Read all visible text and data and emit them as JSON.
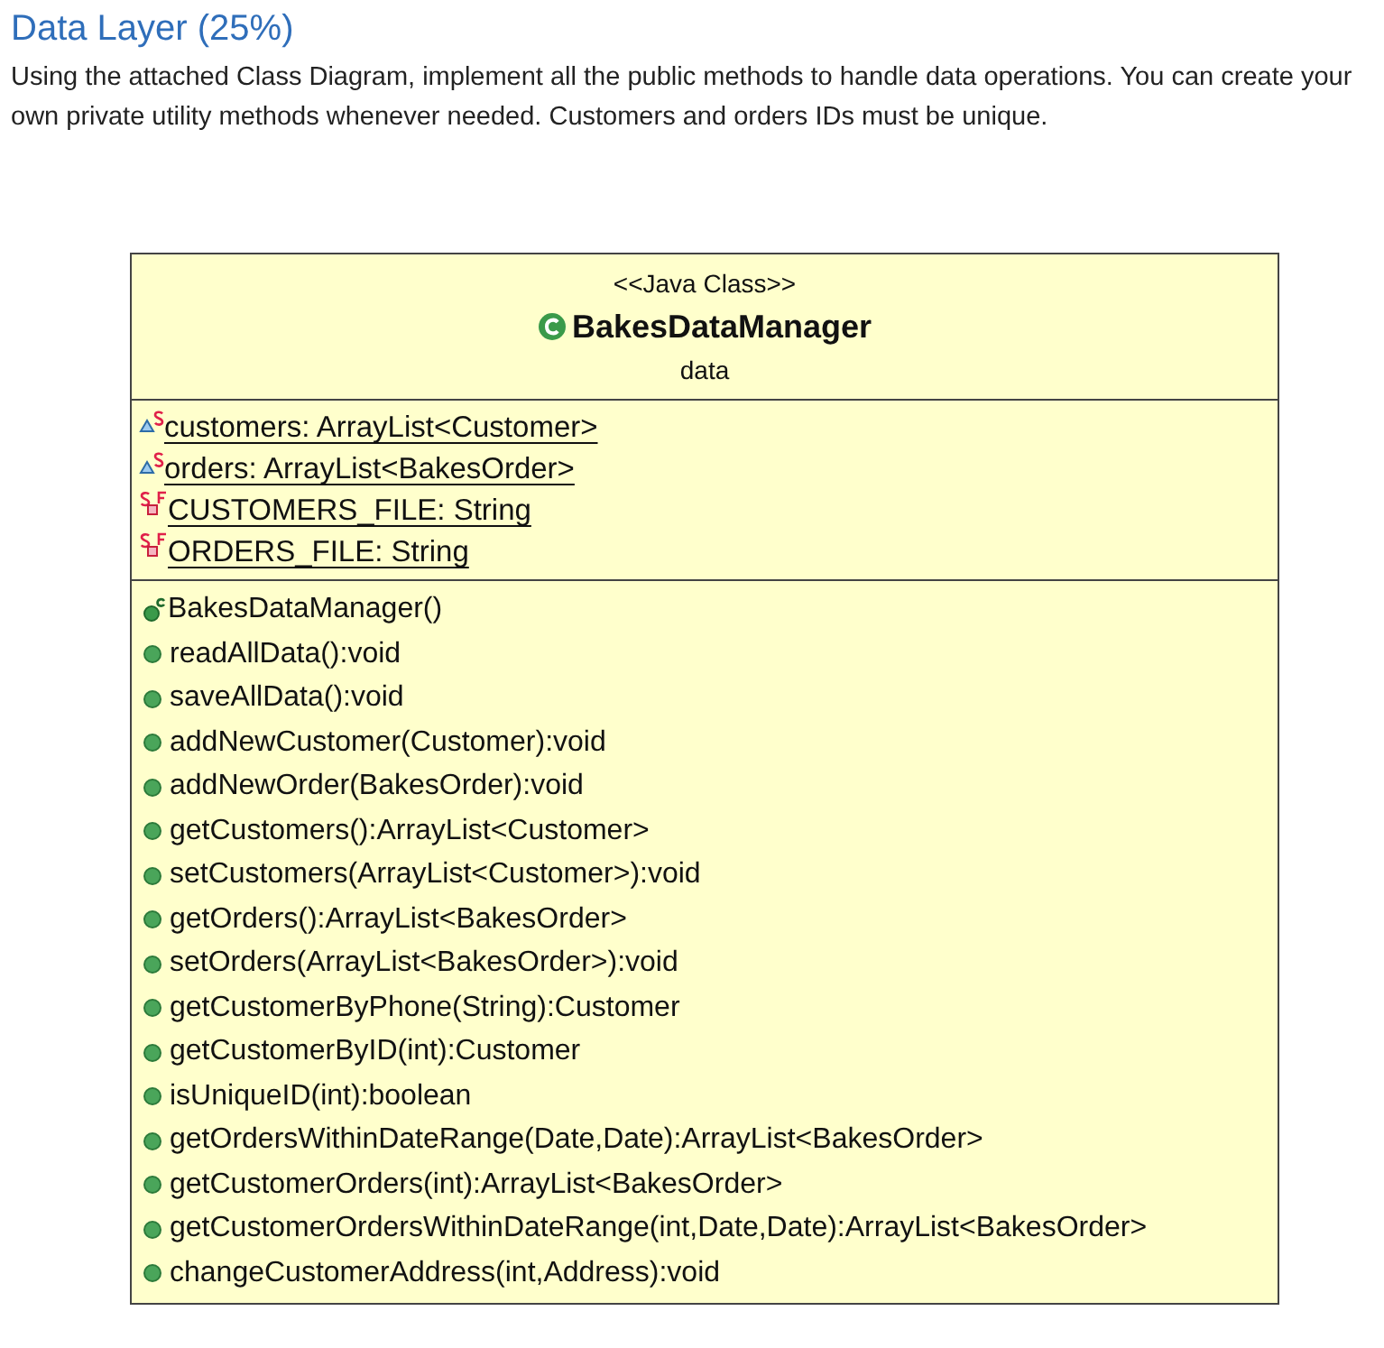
{
  "heading": "Data Layer (25%)",
  "paragraph": "Using the attached Class Diagram, implement all the public methods to handle data operations. You can create your own private utility methods whenever needed. Customers and orders IDs must be unique.",
  "class_diagram": {
    "stereotype": "<<Java Class>>",
    "name": "BakesDataManager",
    "package": "data",
    "fields": [
      {
        "kind": "package-static",
        "text": "customers: ArrayList<Customer>"
      },
      {
        "kind": "package-static",
        "text": "orders: ArrayList<BakesOrder>"
      },
      {
        "kind": "private-static-final",
        "text": "CUSTOMERS_FILE: String"
      },
      {
        "kind": "private-static-final",
        "text": "ORDERS_FILE: String"
      }
    ],
    "methods": [
      {
        "kind": "constructor",
        "text": "BakesDataManager()"
      },
      {
        "kind": "method",
        "text": "readAllData():void"
      },
      {
        "kind": "method",
        "text": "saveAllData():void"
      },
      {
        "kind": "method",
        "text": "addNewCustomer(Customer):void"
      },
      {
        "kind": "method",
        "text": "addNewOrder(BakesOrder):void"
      },
      {
        "kind": "method",
        "text": "getCustomers():ArrayList<Customer>"
      },
      {
        "kind": "method",
        "text": "setCustomers(ArrayList<Customer>):void"
      },
      {
        "kind": "method",
        "text": "getOrders():ArrayList<BakesOrder>"
      },
      {
        "kind": "method",
        "text": "setOrders(ArrayList<BakesOrder>):void"
      },
      {
        "kind": "method",
        "text": "getCustomerByPhone(String):Customer"
      },
      {
        "kind": "method",
        "text": "getCustomerByID(int):Customer"
      },
      {
        "kind": "method",
        "text": "isUniqueID(int):boolean"
      },
      {
        "kind": "method",
        "text": "getOrdersWithinDateRange(Date,Date):ArrayList<BakesOrder>"
      },
      {
        "kind": "method",
        "text": "getCustomerOrders(int):ArrayList<BakesOrder>"
      },
      {
        "kind": "method",
        "text": "getCustomerOrdersWithinDateRange(int,Date,Date):ArrayList<BakesOrder>"
      },
      {
        "kind": "method",
        "text": "changeCustomerAddress(int,Address):void"
      }
    ]
  }
}
